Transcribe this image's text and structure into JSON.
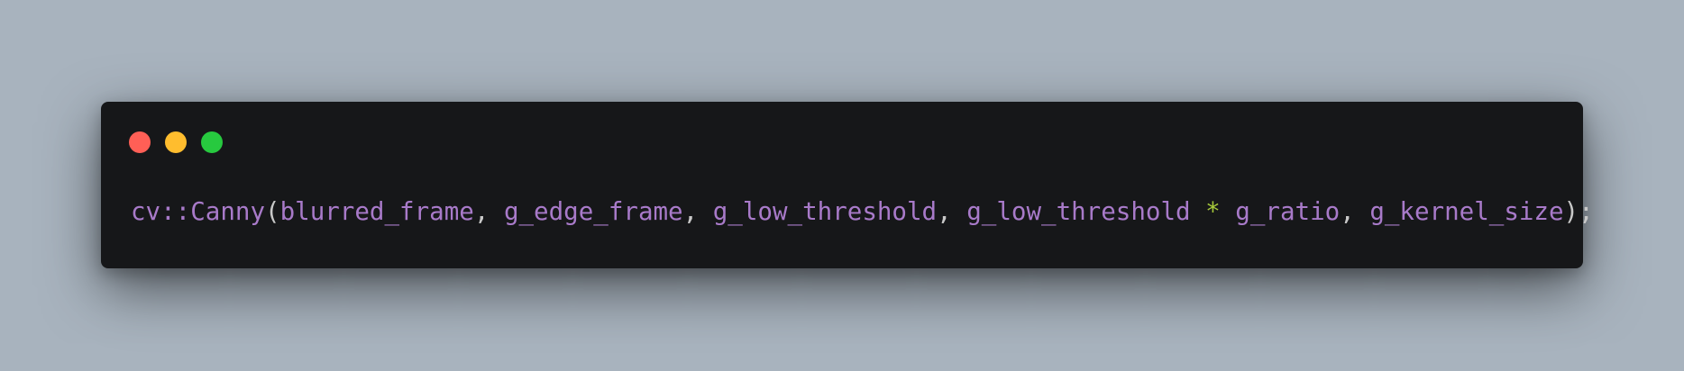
{
  "theme": {
    "page_background": "#a8b3be",
    "window_background": "#161719",
    "close_color": "#ff5f56",
    "minimize_color": "#ffbd2e",
    "zoom_color": "#27c93f",
    "identifier_color": "#a87ac9",
    "punctuation_color": "#c8c8c8",
    "operator_color": "#a6c93a"
  },
  "window": {
    "buttons": [
      {
        "name": "close",
        "icon": "red-dot"
      },
      {
        "name": "minimize",
        "icon": "yellow-dot"
      },
      {
        "name": "zoom",
        "icon": "green-dot"
      }
    ]
  },
  "code": {
    "tokens": {
      "namespace_call": "cv::Canny",
      "open_paren": "(",
      "arg_blurred_frame": "blurred_frame",
      "comma_1": ", ",
      "arg_edge_frame": "g_edge_frame",
      "comma_2": ", ",
      "arg_low_threshold_1": "g_low_threshold",
      "comma_3": ", ",
      "arg_low_threshold_2": "g_low_threshold",
      "space_before_operator": " ",
      "operator_multiply": "*",
      "space_after_operator": " ",
      "arg_ratio": "g_ratio",
      "comma_4": ", ",
      "arg_kernel_size": "g_kernel_size",
      "close_paren": ")",
      "semicolon": ";"
    }
  }
}
